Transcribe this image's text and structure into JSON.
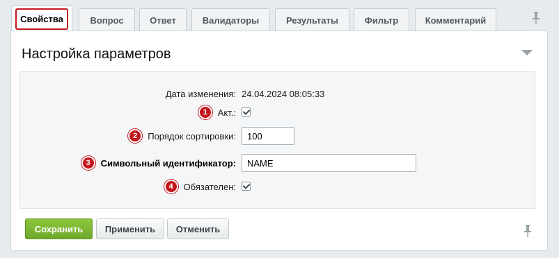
{
  "tabs": [
    {
      "label": "Свойства",
      "active": true
    },
    {
      "label": "Вопрос"
    },
    {
      "label": "Ответ"
    },
    {
      "label": "Валидаторы"
    },
    {
      "label": "Результаты"
    },
    {
      "label": "Фильтр"
    },
    {
      "label": "Комментарий"
    }
  ],
  "panel": {
    "title": "Настройка параметров"
  },
  "form": {
    "date_label": "Дата изменения:",
    "date_value": "24.04.2024 08:05:33",
    "active_label": "Акт.:",
    "active_badge": "1",
    "active_checked": true,
    "sort_label": "Порядок сортировки:",
    "sort_badge": "2",
    "sort_value": "100",
    "code_label": "Символьный идентификатор:",
    "code_badge": "3",
    "code_value": "NAME",
    "required_label": "Обязателен:",
    "required_badge": "4",
    "required_checked": true
  },
  "buttons": {
    "save": "Сохранить",
    "apply": "Применить",
    "cancel": "Отменить"
  },
  "icons": {
    "pin": "pin-icon",
    "collapse": "triangle-down-icon"
  },
  "colors": {
    "accent_red": "#c4161c",
    "save_green": "#7ab733"
  }
}
